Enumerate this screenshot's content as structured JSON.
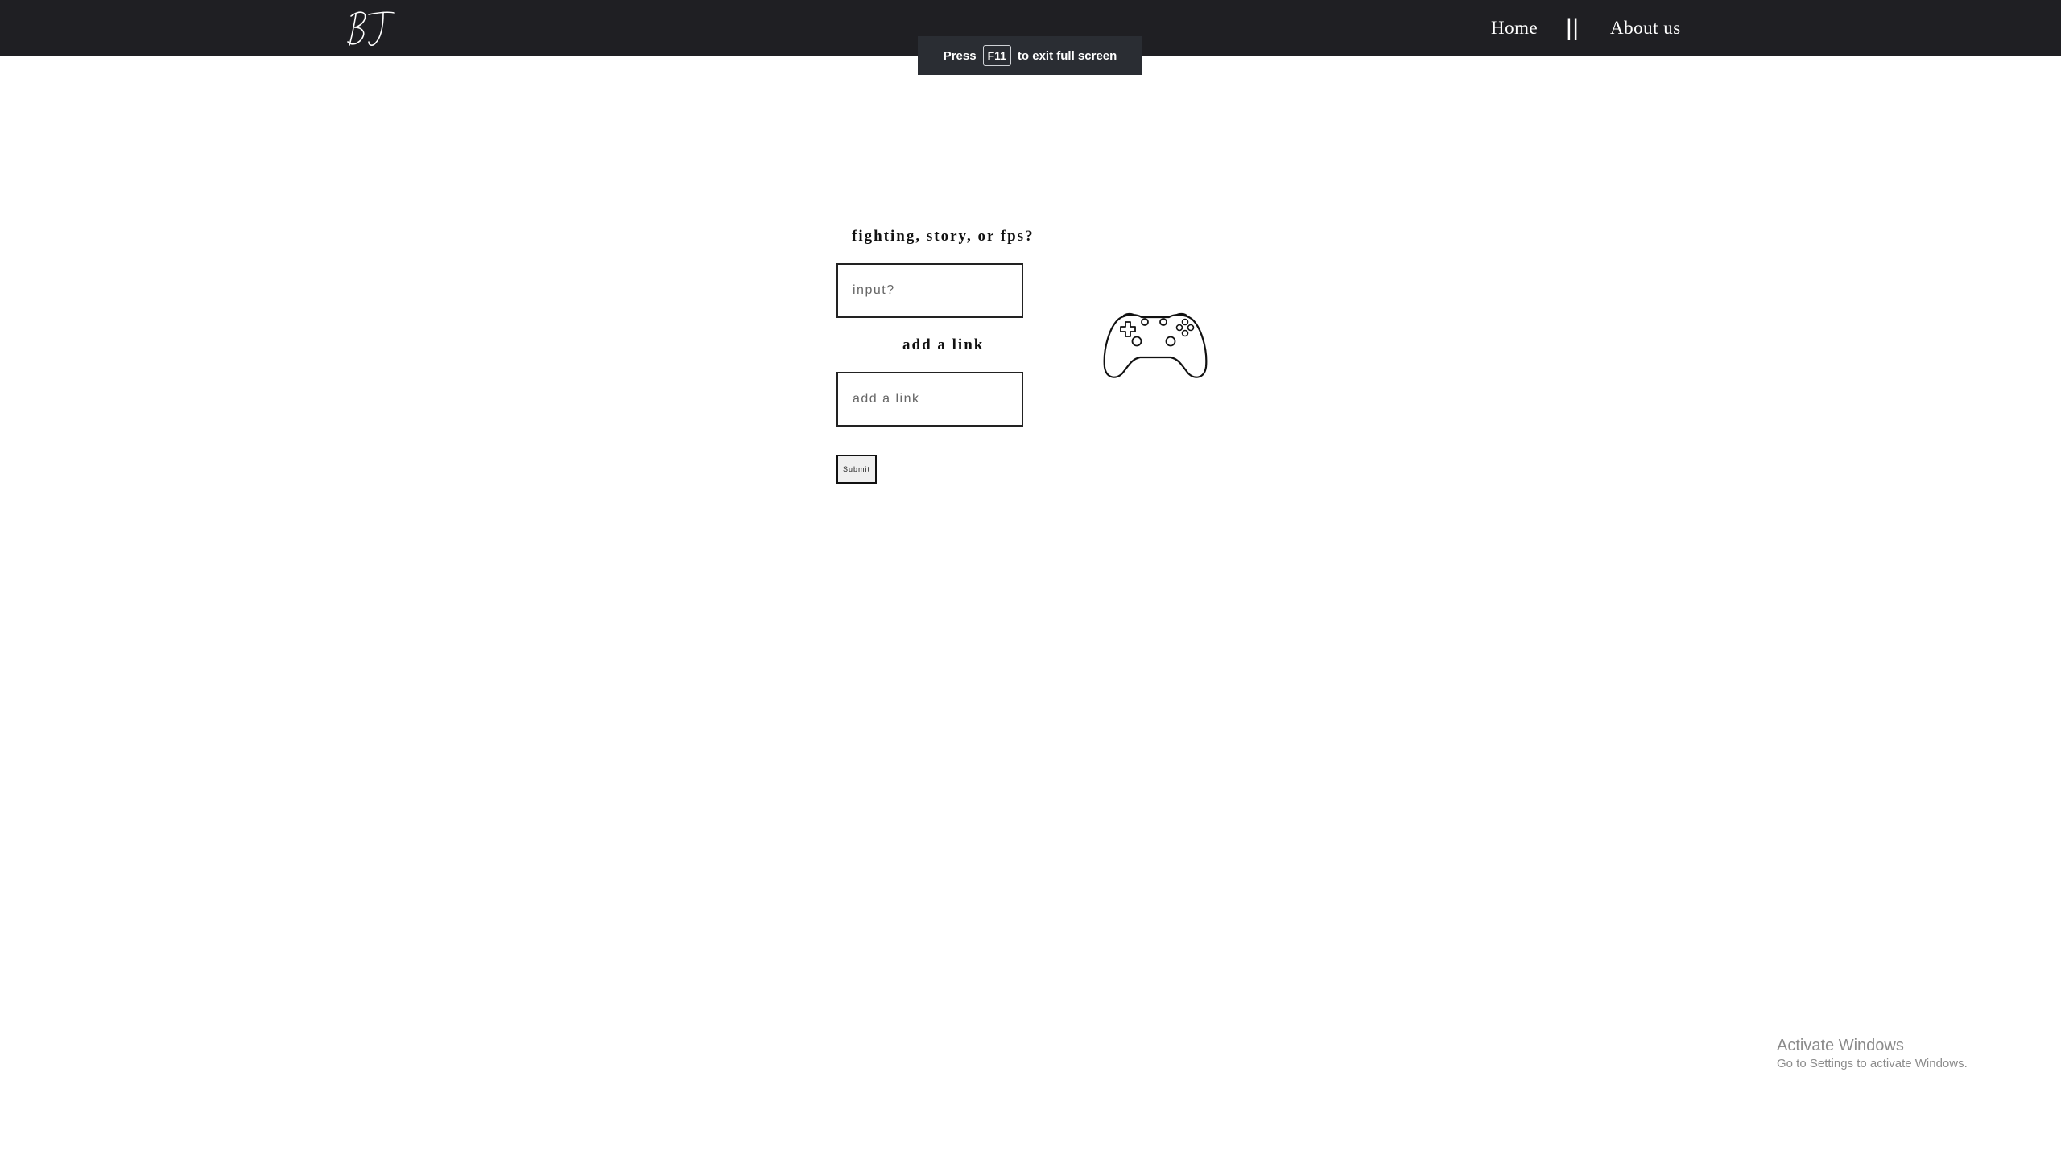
{
  "header": {
    "logo_text": "BJ",
    "nav": {
      "home": "Home",
      "separator": "||",
      "about": "About us"
    }
  },
  "fullscreen_toast": {
    "prefix": "Press",
    "key": "F11",
    "suffix": "to exit full screen"
  },
  "form": {
    "genre_label": "fighting, story, or fps?",
    "genre_placeholder": "input?",
    "link_label": "add a link",
    "link_placeholder": "add a link",
    "submit_label": "Submit"
  },
  "icons": {
    "controller": "game-controller-icon"
  },
  "watermark": {
    "title": "Activate Windows",
    "subtitle": "Go to Settings to activate Windows."
  },
  "colors": {
    "header_bg": "#1f1f23",
    "toast_bg": "#2a2d33",
    "page_bg": "#ffffff"
  }
}
